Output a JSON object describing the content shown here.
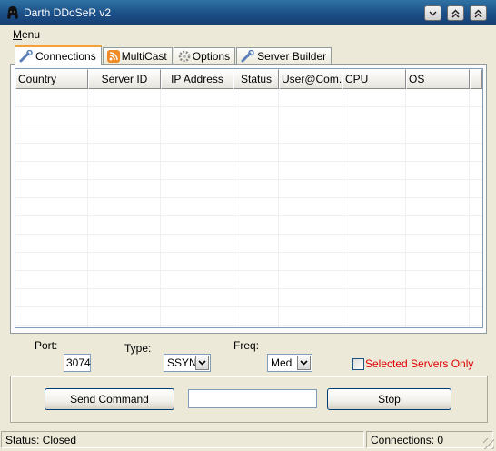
{
  "window": {
    "title": "Darth DDoSeR v2",
    "accent_color": "#1b4e86",
    "controls": [
      "minimize-icon",
      "restore-icon",
      "close-icon"
    ]
  },
  "menubar": {
    "menu_first": "M",
    "menu_rest": "enu"
  },
  "tabs": [
    {
      "label": "Connections",
      "icon": "wrench-icon",
      "active": true
    },
    {
      "label": "MultiCast",
      "icon": "rss-icon",
      "active": false
    },
    {
      "label": "Options",
      "icon": "gear-icon",
      "active": false
    },
    {
      "label": "Server Builder",
      "icon": "wrench-icon",
      "active": false
    }
  ],
  "table": {
    "columns": [
      "Country",
      "Server ID",
      "IP Address",
      "Status",
      "User@Com...",
      "CPU",
      "OS"
    ],
    "rows": []
  },
  "settings": {
    "port_label": "Port:",
    "port_value": "3074",
    "type_label": "Type:",
    "type_value": "SSYN",
    "freq_label": "Freq:",
    "freq_value": "Med",
    "selected_only_label": "Selected Servers Only",
    "selected_only_color": "#e00000"
  },
  "command": {
    "send_label": "Send Command",
    "input_value": "",
    "stop_label": "Stop"
  },
  "status": {
    "left": "Status: Closed",
    "right": "Connections: 0"
  }
}
